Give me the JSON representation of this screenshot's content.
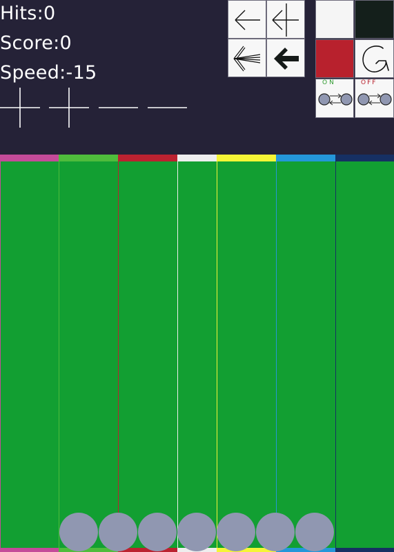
{
  "stats": {
    "hits": "Hits:0",
    "score": "Score:0",
    "speed": "Speed:-15"
  },
  "symbols": [
    "plus",
    "plus",
    "minus",
    "minus"
  ],
  "arrow_buttons": [
    {
      "name": "arrow-thin-left-button",
      "icon": "thin-left-arrow-icon"
    },
    {
      "name": "arrow-branch-left-button",
      "icon": "branch-left-arrow-icon"
    },
    {
      "name": "arrow-multi-left-button",
      "icon": "multi-line-left-arrow-icon"
    },
    {
      "name": "arrow-bold-left-button",
      "icon": "bold-left-arrow-icon"
    }
  ],
  "controls": {
    "colors": {
      "white": "#f5f5f5",
      "dark": "#141f1b",
      "red": "#b8212d"
    },
    "restart_icon": "restart-icon",
    "toggle_on_label": "ON",
    "toggle_off_label": "OFF",
    "toggle_on_color": "#2f9a2f",
    "toggle_off_color": "#b8212d"
  },
  "lanes": [
    {
      "color": "#c44b99"
    },
    {
      "color": "#4fbc3c"
    },
    {
      "color": "#bb2230"
    },
    {
      "color": "#eeeeee"
    },
    {
      "color": "#f5f536"
    },
    {
      "color": "#2497d9"
    },
    {
      "color": "#163063"
    }
  ],
  "lane_fill": "#129f32",
  "ball_color": "#9097b1",
  "ball_count": 7
}
